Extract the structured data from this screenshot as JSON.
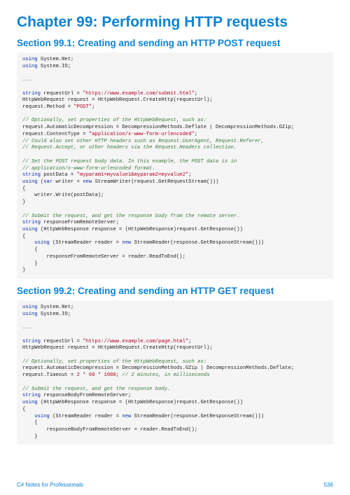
{
  "chapter_title": "Chapter 99: Performing HTTP requests",
  "section1_title": "Section 99.1: Creating and sending an HTTP POST request",
  "section2_title": "Section 99.2: Creating and sending an HTTP GET request",
  "footer_left": "C# Notes for Professionals",
  "footer_right": "536",
  "code1": {
    "l1a": "using",
    "l1b": " System.Net;",
    "l2a": "using",
    "l2b": " System.IO;",
    "l3": "...",
    "l4a": "string",
    "l4b": " requestUrl = ",
    "l4c": "\"https://www.example.com/submit.html\"",
    "l4d": ";",
    "l5": "HttpWebRequest request = HttpWebRequest.CreateHttp(requestUrl);",
    "l6a": "request.Method = ",
    "l6b": "\"POST\"",
    "l6c": ";",
    "l7": "// Optionally, set properties of the HttpWebRequest, such as:",
    "l8": "request.AutomaticDecompression = DecompressionMethods.Deflate | DecompressionMethods.GZip;",
    "l9a": "request.ContentType = ",
    "l9b": "\"application/x-www-form-urlencoded\"",
    "l9c": ";",
    "l10": "// Could also set other HTTP headers such as Request.UserAgent, Request.Referer,",
    "l11": "// Request.Accept, or other headers via the Request.Headers collection.",
    "l12": "// Set the POST request body data. In this example, the POST data is in",
    "l13": "// application/x-www-form-urlencoded format.",
    "l14a": "string",
    "l14b": " postData = ",
    "l14c": "\"myparam1=myvalue1&myparam2=myvalue2\"",
    "l14d": ";",
    "l15a": "using",
    "l15b": " (",
    "l15c": "var",
    "l15d": " writer = ",
    "l15e": "new",
    "l15f": " StreamWriter(request.GetRequestStream()))",
    "l16": "{",
    "l17": "    writer.Write(postData);",
    "l18": "}",
    "l19": "// Submit the request, and get the response body from the remote server.",
    "l20a": "string",
    "l20b": " responseFromRemoteServer;",
    "l21a": "using",
    "l21b": " (HttpWebResponse response = (HttpWebResponse)request.GetResponse())",
    "l22": "{",
    "l23a": "    ",
    "l23b": "using",
    "l23c": " (StreamReader reader = ",
    "l23d": "new",
    "l23e": " StreamReader(response.GetResponseStream()))",
    "l24": "    {",
    "l25": "        responseFromRemoteServer = reader.ReadToEnd();",
    "l26": "    }",
    "l27": "}"
  },
  "code2": {
    "l1a": "using",
    "l1b": " System.Net;",
    "l2a": "using",
    "l2b": " System.IO;",
    "l3": "...",
    "l4a": "string",
    "l4b": " requestUrl = ",
    "l4c": "\"https://www.example.com/page.html\"",
    "l4d": ";",
    "l5": "HttpWebRequest request = HttpWebRequest.CreateHttp(requestUrl);",
    "l6": "// Optionally, set properties of the HttpWebRequest, such as:",
    "l7": "request.AutomaticDecompression = DecompressionMethods.GZip | DecompressionMethods.Deflate;",
    "l8a": "request.Timeout = ",
    "l8b": "2",
    "l8c": " * ",
    "l8d": "60",
    "l8e": " * ",
    "l8f": "1000",
    "l8g": "; ",
    "l8h": "// 2 minutes, in milliseconds",
    "l9": "// Submit the request, and get the response body.",
    "l10a": "string",
    "l10b": " responseBodyFromRemoteServer;",
    "l11a": "using",
    "l11b": " (HttpWebResponse response = (HttpWebResponse)request.GetResponse())",
    "l12": "{",
    "l13a": "    ",
    "l13b": "using",
    "l13c": " (StreamReader reader = ",
    "l13d": "new",
    "l13e": " StreamReader(response.GetResponseStream()))",
    "l14": "    {",
    "l15": "        responseBodyFromRemoteServer = reader.ReadToEnd();",
    "l16": "    }"
  }
}
